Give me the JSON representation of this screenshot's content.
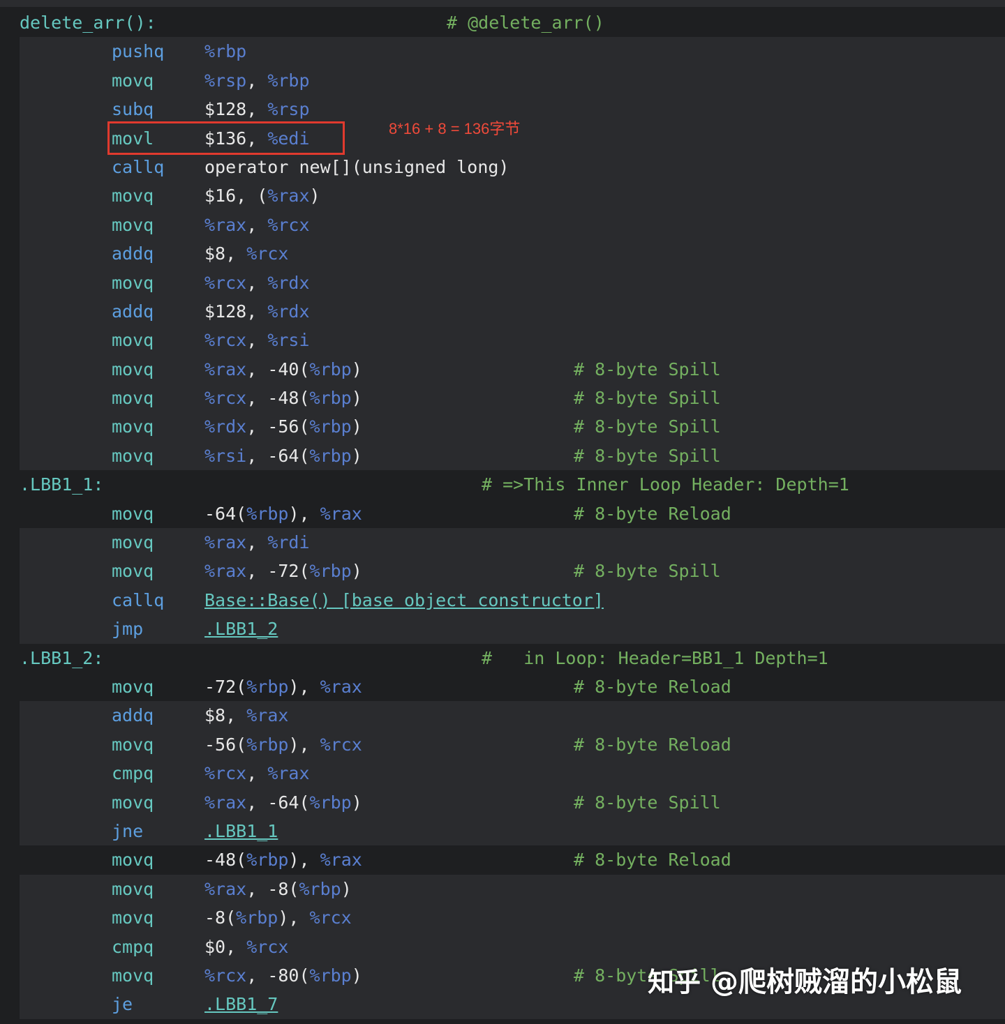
{
  "function": {
    "label": "delete_arr():",
    "comment": "# @delete_arr()"
  },
  "annotation": "8*16 + 8 = 136字节",
  "watermark": {
    "brand": "知乎",
    "handle": "@爬树贼溜的小松鼠"
  },
  "colors": {
    "background": "#1e1f21",
    "band": "#2a2b2e",
    "mnemonic": "#5d9fe0",
    "register": "#5a7fd0",
    "label": "#66c8c0",
    "comment": "#74b060",
    "annotation": "#e03a2e"
  },
  "lines": [
    {
      "mn": "pushq",
      "ops": "%rbp"
    },
    {
      "mn": "movq",
      "ops": "%rsp, %rbp"
    },
    {
      "mn": "subq",
      "ops": "$128, %rsp"
    },
    {
      "mn": "movl",
      "ops": "$136, %edi"
    },
    {
      "mn": "callq",
      "ops": "operator new[](unsigned long)"
    },
    {
      "mn": "movq",
      "ops": "$16, (%rax)"
    },
    {
      "mn": "movq",
      "ops": "%rax, %rcx"
    },
    {
      "mn": "addq",
      "ops": "$8, %rcx"
    },
    {
      "mn": "movq",
      "ops": "%rcx, %rdx"
    },
    {
      "mn": "addq",
      "ops": "$128, %rdx"
    },
    {
      "mn": "movq",
      "ops": "%rcx, %rsi"
    },
    {
      "mn": "movq",
      "ops": "%rax, -40(%rbp)",
      "cmt": "# 8-byte Spill"
    },
    {
      "mn": "movq",
      "ops": "%rcx, -48(%rbp)",
      "cmt": "# 8-byte Spill"
    },
    {
      "mn": "movq",
      "ops": "%rdx, -56(%rbp)",
      "cmt": "# 8-byte Spill"
    },
    {
      "mn": "movq",
      "ops": "%rsi, -64(%rbp)",
      "cmt": "# 8-byte Spill"
    },
    {
      "label": ".LBB1_1:",
      "lcmt": "# =>This Inner Loop Header: Depth=1"
    },
    {
      "mn": "movq",
      "ops": "-64(%rbp), %rax",
      "cmt": "# 8-byte Reload"
    },
    {
      "mn": "movq",
      "ops": "%rax, %rdi"
    },
    {
      "mn": "movq",
      "ops": "%rax, -72(%rbp)",
      "cmt": "# 8-byte Spill"
    },
    {
      "mn": "callq",
      "ops": "Base::Base() [base object constructor]"
    },
    {
      "mn": "jmp",
      "ops": ".LBB1_2"
    },
    {
      "label": ".LBB1_2:",
      "lcmt": "#   in Loop: Header=BB1_1 Depth=1"
    },
    {
      "mn": "movq",
      "ops": "-72(%rbp), %rax",
      "cmt": "# 8-byte Reload"
    },
    {
      "mn": "addq",
      "ops": "$8, %rax"
    },
    {
      "mn": "movq",
      "ops": "-56(%rbp), %rcx",
      "cmt": "# 8-byte Reload"
    },
    {
      "mn": "cmpq",
      "ops": "%rcx, %rax"
    },
    {
      "mn": "movq",
      "ops": "%rax, -64(%rbp)",
      "cmt": "# 8-byte Spill"
    },
    {
      "mn": "jne",
      "ops": ".LBB1_1"
    },
    {
      "mn": "movq",
      "ops": "-48(%rbp), %rax",
      "cmt": "# 8-byte Reload"
    },
    {
      "mn": "movq",
      "ops": "%rax, -8(%rbp)"
    },
    {
      "mn": "movq",
      "ops": "-8(%rbp), %rcx"
    },
    {
      "mn": "cmpq",
      "ops": "$0, %rcx"
    },
    {
      "mn": "movq",
      "ops": "%rcx, -80(%rbp)",
      "cmt": "# 8-byte Spill"
    },
    {
      "mn": "je",
      "ops": ".LBB1_7"
    }
  ]
}
